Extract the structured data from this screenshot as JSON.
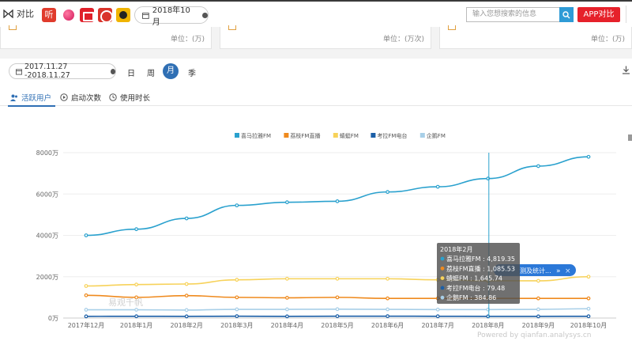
{
  "toolbar": {
    "compare_label": "对比",
    "app_icon_1_text": "听",
    "month": "2018年10月",
    "search_placeholder": "输入您想搜索的信息",
    "app_compare_button": "APP对比"
  },
  "cards": [
    {
      "unit": "单位：(万)"
    },
    {
      "unit": "单位：(万次)"
    },
    {
      "unit": "单位：(万)"
    }
  ],
  "filters": {
    "date_range": "2017.11.27 -2018.11.27",
    "periods": [
      "日",
      "周",
      "月",
      "季"
    ],
    "selected_period": "月"
  },
  "tabs": [
    "活跃用户",
    "启动次数",
    "使用时长"
  ],
  "chart_data": {
    "type": "line",
    "categories": [
      "2017年12月",
      "2018年1月",
      "2018年2月",
      "2018年3月",
      "2018年4月",
      "2018年5月",
      "2018年6月",
      "2018年7月",
      "2018年8月",
      "2018年9月",
      "2018年10月"
    ],
    "yticks": [
      "0万",
      "2000万",
      "4000万",
      "6000万",
      "8000万"
    ],
    "ylim": [
      0,
      8000
    ],
    "grid": true,
    "legend_position": "top-center",
    "series": [
      {
        "name": "喜马拉雅FM",
        "color": "#2aa1ce",
        "values": [
          4000,
          4300,
          4819.35,
          5450,
          5600,
          5650,
          6100,
          6350,
          6750,
          7350,
          7800
        ]
      },
      {
        "name": "荔枝FM直播",
        "color": "#ef8a1e",
        "values": [
          1100,
          1000,
          1085.53,
          1000,
          980,
          1000,
          950,
          950,
          950,
          950,
          950
        ]
      },
      {
        "name": "蜻蜓FM",
        "color": "#f7d25a",
        "values": [
          1550,
          1620,
          1645.74,
          1850,
          1900,
          1900,
          1900,
          1850,
          1800,
          1800,
          2000
        ]
      },
      {
        "name": "考拉FM电台",
        "color": "#1c5fa7",
        "values": [
          80,
          85,
          79.48,
          90,
          80,
          90,
          90,
          85,
          80,
          80,
          85
        ]
      },
      {
        "name": "企鹅FM",
        "color": "#a8cfe8",
        "values": [
          400,
          400,
          384.86,
          420,
          420,
          430,
          420,
          410,
          410,
          420,
          450
        ]
      }
    ],
    "tooltip": {
      "title": "2018年2月",
      "rows": [
        "喜马拉雅FM : 4,819.35",
        "荔枝FM直播 : 1,085.53",
        "蜻蜓FM : 1,645.74",
        "考拉FM电台 : 79.48",
        "企鹅FM : 384.86"
      ]
    },
    "overlay_badge": "测及统计..."
  },
  "watermark": "易观千帆",
  "powered_by": "Powered by qianfan.analysys.cn"
}
